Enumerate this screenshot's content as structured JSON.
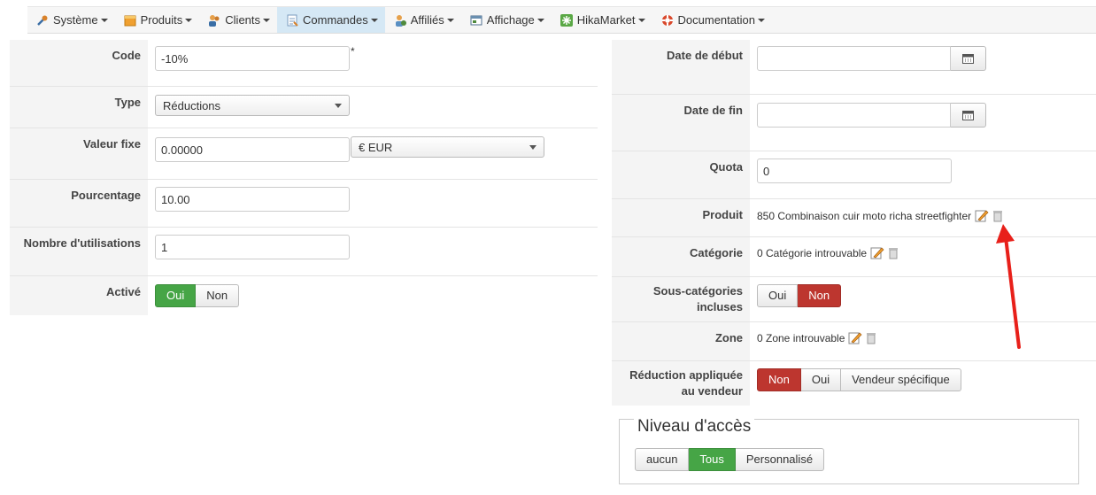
{
  "menu": {
    "items": [
      {
        "label": "Système",
        "icon": "wrench-icon",
        "color": "#d9822b"
      },
      {
        "label": "Produits",
        "icon": "box-icon",
        "color": "#f0a030"
      },
      {
        "label": "Clients",
        "icon": "users-icon",
        "color": "#c97a2b"
      },
      {
        "label": "Commandes",
        "icon": "orders-icon",
        "color": "#7a9bbf"
      },
      {
        "label": "Affiliés",
        "icon": "affiliates-icon",
        "color": "#5a8fc2"
      },
      {
        "label": "Affichage",
        "icon": "display-icon",
        "color": "#4f8a3d"
      },
      {
        "label": "HikaMarket",
        "icon": "hikamarket-icon",
        "color": "#5aa845"
      },
      {
        "label": "Documentation",
        "icon": "lifebuoy-icon",
        "color": "#d9482b"
      }
    ],
    "active": "Commandes"
  },
  "left": {
    "code": {
      "label": "Code",
      "value": "-10%",
      "required": "*"
    },
    "type": {
      "label": "Type",
      "value": "Réductions"
    },
    "fixed": {
      "label": "Valeur fixe",
      "value": "0.00000",
      "currency": "€ EUR"
    },
    "percent": {
      "label": "Pourcentage",
      "value": "10.00"
    },
    "uses": {
      "label": "Nombre d'utilisations",
      "value": "1"
    },
    "active": {
      "label": "Activé",
      "yes": "Oui",
      "no": "Non",
      "selected": "Oui"
    }
  },
  "right": {
    "start": {
      "label": "Date de début",
      "value": ""
    },
    "end": {
      "label": "Date de fin",
      "value": ""
    },
    "quota": {
      "label": "Quota",
      "value": "0"
    },
    "product": {
      "label": "Produit",
      "value": "850 Combinaison cuir moto richa streetfighter"
    },
    "category": {
      "label": "Catégorie",
      "value": "0 Catégorie introuvable"
    },
    "subcats": {
      "label": "Sous-catégories incluses",
      "yes": "Oui",
      "no": "Non",
      "selected": "Non"
    },
    "zone": {
      "label": "Zone",
      "value": "0 Zone introuvable"
    },
    "vendor": {
      "label": "Réduction appliquée au vendeur",
      "no": "Non",
      "yes": "Oui",
      "specific": "Vendeur spécifique",
      "selected": "Non"
    }
  },
  "access": {
    "legend": "Niveau d'accès",
    "none": "aucun",
    "all": "Tous",
    "custom": "Personnalisé",
    "selected": "Tous"
  },
  "colors": {
    "green": "#46a546",
    "red": "#bd362f",
    "annotation_arrow": "#e8201a"
  }
}
